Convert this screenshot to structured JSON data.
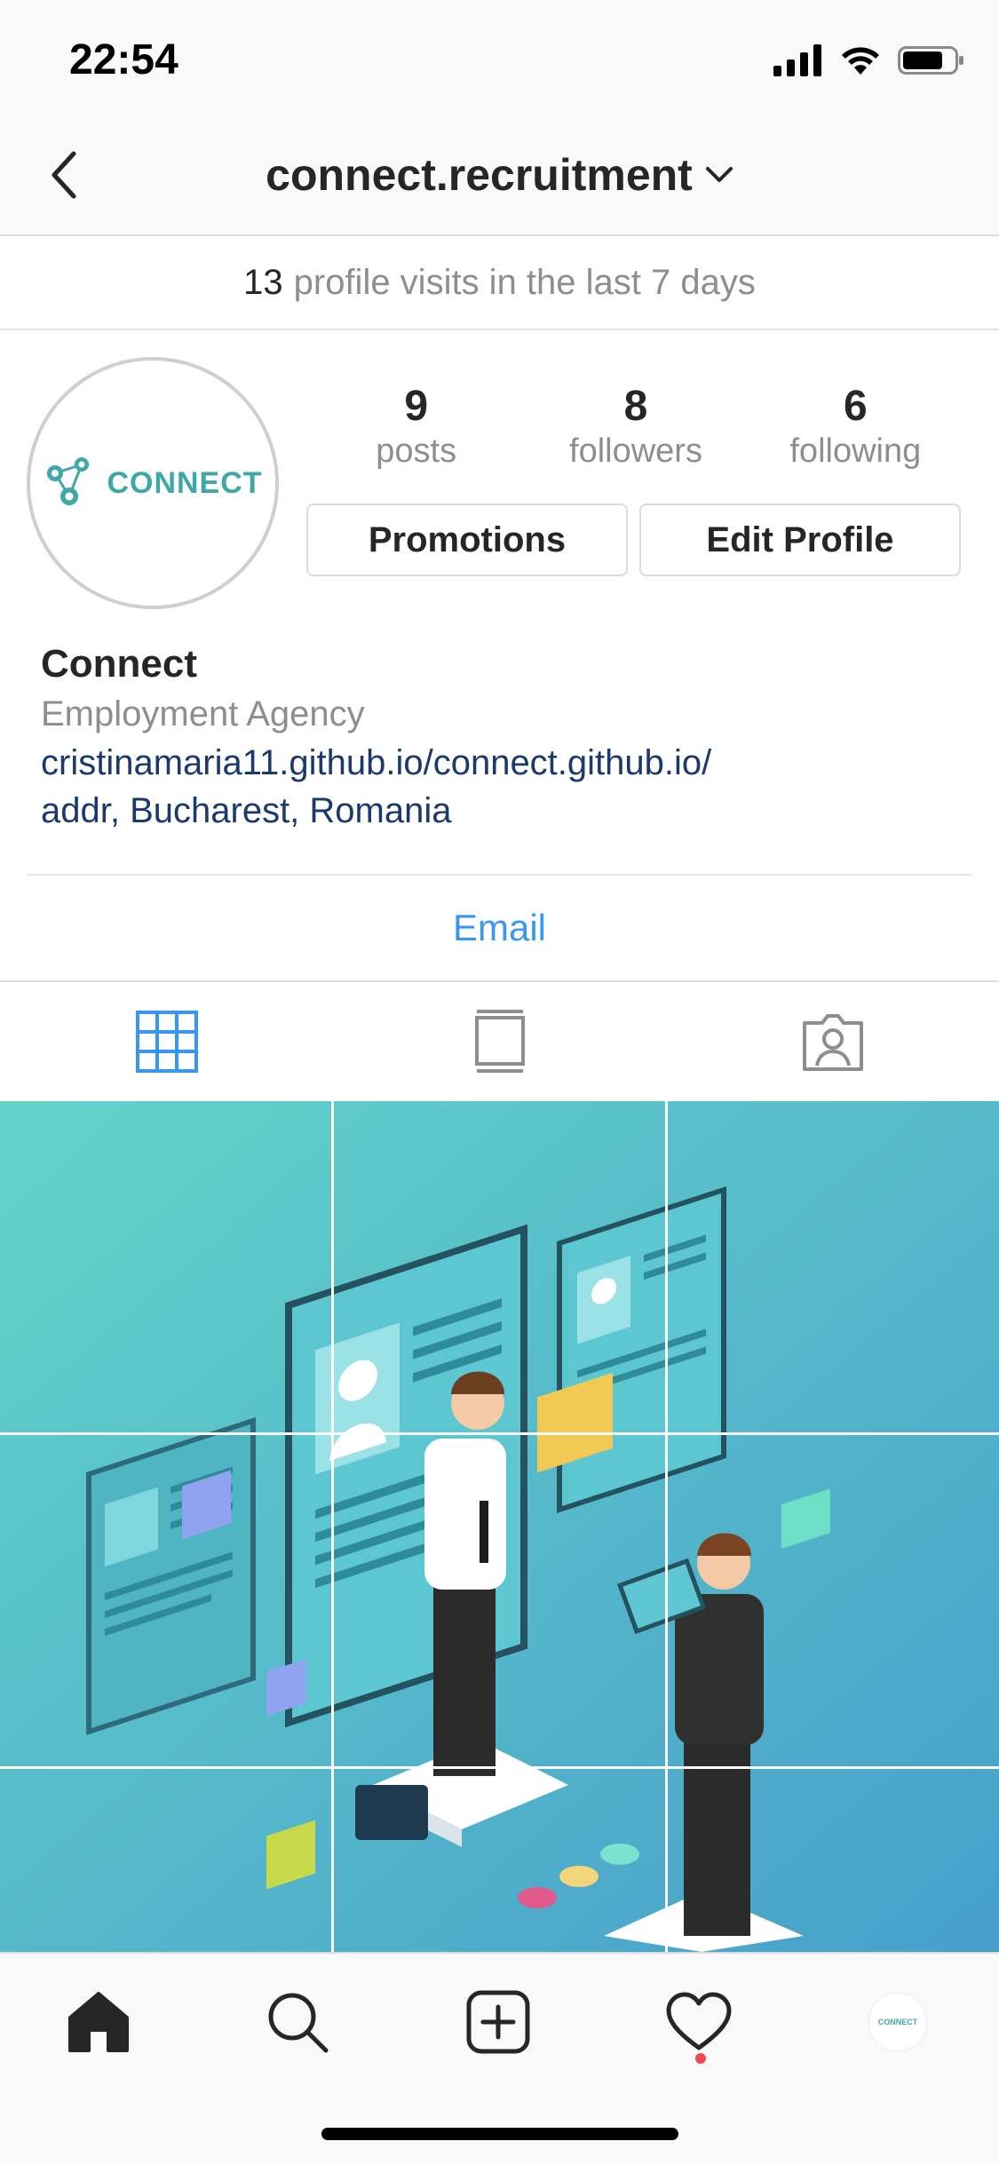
{
  "status_bar": {
    "time": "22:54",
    "icons": [
      "cellular-signal-icon",
      "wifi-icon",
      "battery-icon"
    ]
  },
  "nav": {
    "back_icon": "chevron-left-icon",
    "title": "connect.recruitment",
    "title_icon": "chevron-down-icon"
  },
  "insights": {
    "count": "13",
    "text": "profile visits in the last 7 days"
  },
  "profile": {
    "avatar_logo_text": "CONNECT",
    "stats": [
      {
        "number": "9",
        "label": "posts"
      },
      {
        "number": "8",
        "label": "followers"
      },
      {
        "number": "6",
        "label": "following"
      }
    ],
    "buttons": {
      "promotions": "Promotions",
      "edit_profile": "Edit Profile"
    },
    "bio": {
      "name": "Connect",
      "category": "Employment Agency",
      "link": "cristinamaria11.github.io/connect.github.io/",
      "address": "addr, Bucharest, Romania"
    },
    "contact": {
      "email": "Email"
    }
  },
  "tabs": [
    {
      "icon": "grid-icon",
      "active": true
    },
    {
      "icon": "feed-list-icon",
      "active": false
    },
    {
      "icon": "tagged-person-icon",
      "active": false
    }
  ],
  "colors": {
    "accent_blue": "#3897f0",
    "link_navy": "#1b3a6b",
    "brand_teal": "#3fa7a8",
    "notification_red": "#ed4956",
    "muted_gray": "#8e8e8e",
    "post_bg_top": "#5ccfc7",
    "post_bg_bottom": "#4aa3c9"
  },
  "bottom_nav": {
    "items": [
      "home-icon",
      "search-icon",
      "new-post-icon",
      "activity-heart-icon",
      "profile-avatar-icon"
    ],
    "avatar_text": "CONNECT"
  }
}
